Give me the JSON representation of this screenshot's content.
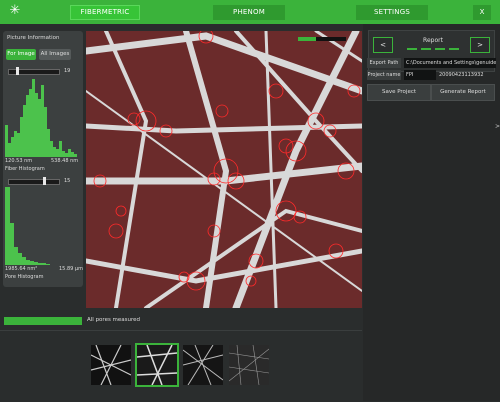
{
  "tabs": [
    {
      "label": "FIBERMETRIC",
      "active": true
    },
    {
      "label": "PHENOM",
      "active": false
    },
    {
      "label": "SETTINGS",
      "active": false
    }
  ],
  "close_label": "X",
  "logo_icon": "snowflake-icon",
  "left_panel": {
    "title": "Picture Information",
    "btn_for_image": "For Image",
    "btn_all_images": "All Images",
    "fiber": {
      "slider_value": "19",
      "min_label": "120.53 nm",
      "max_label": "538.48 nm",
      "title": "Fiber Histogram"
    },
    "pore": {
      "slider_value": "15",
      "min_label": "1985.64 nm²",
      "max_label": "15.89 µm",
      "title": "Pore Histogram"
    }
  },
  "right_panel": {
    "prev_label": "<",
    "next_label": ">",
    "report_label": "Report",
    "export_path_label": "Export Path",
    "export_path_value": "C:\\Documents and Settings\\genuide",
    "project_name_label": "Project name",
    "project_name_value": "FPI",
    "project_id": "20090423113932",
    "save_project": "Save Project",
    "generate_report": "Generate Report"
  },
  "side_arrow": ">",
  "progress": {
    "fraction": 1.0,
    "text": "All pores measured"
  },
  "thumbnails": [
    {
      "name": "thumbnail-1",
      "selected": false
    },
    {
      "name": "thumbnail-2",
      "selected": true
    },
    {
      "name": "thumbnail-3",
      "selected": false
    },
    {
      "name": "thumbnail-4",
      "selected": false
    }
  ],
  "colors": {
    "accent": "#3bb33b",
    "background": "#2a2d2d",
    "overlay_red": "#e02020"
  }
}
